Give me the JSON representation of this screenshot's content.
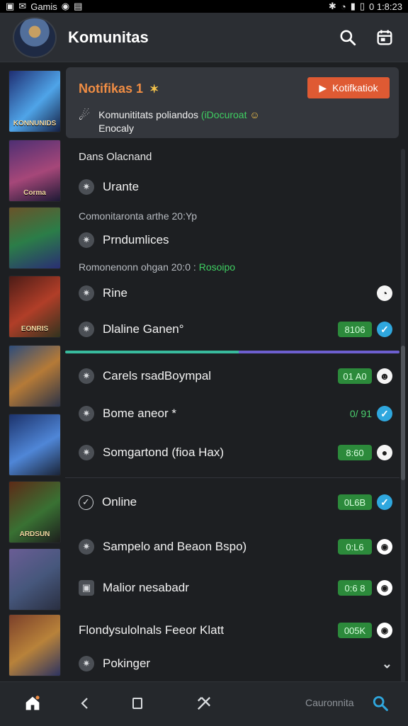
{
  "status_bar": {
    "app": "Gamis",
    "time": "0 1:8:23"
  },
  "app_bar": {
    "title": "Komunitas"
  },
  "notification": {
    "title": "Notifikas 1",
    "button_label": "Kotifkatiok",
    "line1": "Komunititats poliandos",
    "line1_green": "(iDocuroat",
    "line2": "Enocaly"
  },
  "sections": {
    "first": "Dans Olacnand",
    "timestamp1": "Comonitaronta arthe 20:Yp",
    "timestamp2_prefix": "Romonenonn ohgan 20:0 :",
    "timestamp2_green": "Rosoipo"
  },
  "items": [
    {
      "label": "Urante",
      "badge": "",
      "icon": "gear-icon",
      "status": ""
    },
    {
      "label": "Prndumlices",
      "badge": "",
      "icon": "gear-icon",
      "status": ""
    },
    {
      "label": "Rine",
      "badge": "",
      "icon": "gear-icon",
      "status": "message-icon"
    },
    {
      "label": "Dlaline Ganen°",
      "badge": "8106",
      "icon": "gear-icon",
      "status": "check-icon"
    },
    {
      "label": "Carels rsadBoympal",
      "badge": "01 A0",
      "icon": "gear-icon",
      "status": "smiley-icon"
    },
    {
      "label": "Bome aneor *",
      "badge": "0/ 91",
      "icon": "gear-icon",
      "status": "check-icon"
    },
    {
      "label": "Somgartond (fioa Hax)",
      "badge": "8:60",
      "icon": "gear-icon",
      "status": "circle-icon"
    },
    {
      "label": "Online",
      "badge": "0L6B",
      "icon": "check-circle-icon",
      "status": "check-icon"
    },
    {
      "label": "Sampelo and Beaon Bspo)",
      "badge": "0:L6",
      "icon": "gear-icon",
      "status": "record-icon"
    },
    {
      "label": "Malior nesabadr",
      "badge": "0:6 8",
      "icon": "square-icon",
      "status": "record-icon"
    },
    {
      "label": "Flondysulolnals Feeor Klatt",
      "badge": "005K",
      "icon": "",
      "status": "record-icon"
    },
    {
      "label": "Pokinger",
      "badge": "",
      "icon": "gear-icon",
      "status": "chevron-down-icon"
    }
  ],
  "thumbs": [
    {
      "label": "KONNUNIDS"
    },
    {
      "label": "Corma"
    },
    {
      "label": ""
    },
    {
      "label": "EONRIS"
    },
    {
      "label": ""
    },
    {
      "label": ""
    },
    {
      "label": "ARDSUN"
    },
    {
      "label": ""
    },
    {
      "label": ""
    }
  ],
  "bottom_nav": {
    "label": "Cauronnita"
  },
  "colors": {
    "accent_orange": "#df5a33",
    "green": "#2c8a3b",
    "blue": "#2fa7de"
  }
}
